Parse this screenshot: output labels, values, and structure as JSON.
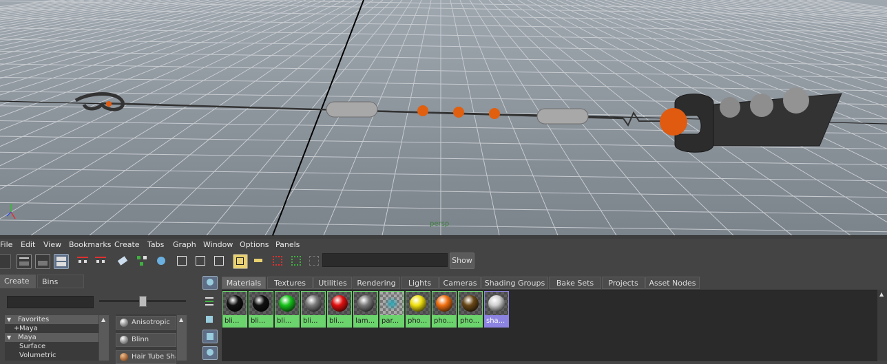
{
  "viewport": {
    "camera_label": "persp"
  },
  "menubar": {
    "items": [
      "File",
      "Edit",
      "View",
      "Bookmarks",
      "Create",
      "Tabs",
      "Graph",
      "Window",
      "Options",
      "Panels"
    ]
  },
  "toolbar": {
    "show_label": "Show",
    "icons": [
      "panel-layout-icon",
      "single-pane-icon",
      "dual-pane-icon",
      "quad-pane-icon",
      "input-output-connections-icon",
      "graph-network-icon",
      "graph-upstream-icon",
      "clear-graph-icon",
      "rearrange-graph-icon",
      "add-selected-icon",
      "remove-selected-icon",
      "hypershade-icon",
      "render-icon",
      "ipr-render-icon",
      "snapshot-icon",
      "frame-selection-icon"
    ]
  },
  "left_panel": {
    "tabs": [
      "Create",
      "Bins"
    ],
    "tree": [
      {
        "label": "Favorites",
        "expanded": true
      },
      {
        "label": "Maya",
        "prefix": "+"
      },
      {
        "label": "Maya",
        "expanded": true
      },
      {
        "label": "Surface"
      },
      {
        "label": "Volumetric"
      }
    ],
    "list": [
      "Anisotropic",
      "Blinn",
      "Hair Tube Sha"
    ]
  },
  "hypershade": {
    "tabs": [
      "Materials",
      "Textures",
      "Utilities",
      "Rendering",
      "Lights",
      "Cameras",
      "Shading Groups",
      "Bake Sets",
      "Projects",
      "Asset Nodes"
    ],
    "active_tab": "Materials",
    "materials": [
      {
        "label": "bli...",
        "color": "#111111"
      },
      {
        "label": "bli...",
        "color": "#111111"
      },
      {
        "label": "bli...",
        "color": "#17c21b"
      },
      {
        "label": "bli...",
        "color": "#7c7c7c"
      },
      {
        "label": "bli...",
        "color": "#e01010"
      },
      {
        "label": "lam...",
        "color": "#7a7a7a"
      },
      {
        "label": "par...",
        "color": "#2aa8b8"
      },
      {
        "label": "pho...",
        "color": "#f0e010"
      },
      {
        "label": "pho...",
        "color": "#f07010"
      },
      {
        "label": "pho...",
        "color": "#6a4818"
      },
      {
        "label": "sha...",
        "color": "#cfcfcf"
      }
    ]
  }
}
